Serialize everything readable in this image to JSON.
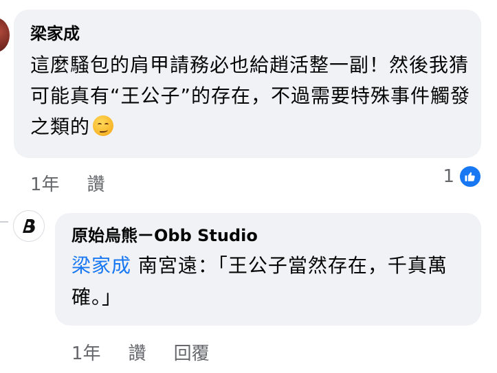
{
  "comment1": {
    "author": "梁家成",
    "text": "這麼騷包的肩甲請務必也給趙活整一副！然後我猜可能真有“王公子”的存在，不過需要特殊事件觸發之類的",
    "emoji": "smirking-face-emoji",
    "time": "1年",
    "like_label": "讚",
    "reaction_count": "1",
    "reaction_icon": "like-icon"
  },
  "comment2": {
    "author": "原始烏熊ㄧObb Studio",
    "mention": "梁家成",
    "text": " 南宮遠：「王公子當然存在，千真萬確。」",
    "time": "1年",
    "like_label": "讚",
    "reply_label": "回覆"
  },
  "colors": {
    "bubble_bg": "#f0f2f5",
    "mention": "#1877f2",
    "meta_text": "#65676b",
    "like_blue": "#1877f2"
  }
}
